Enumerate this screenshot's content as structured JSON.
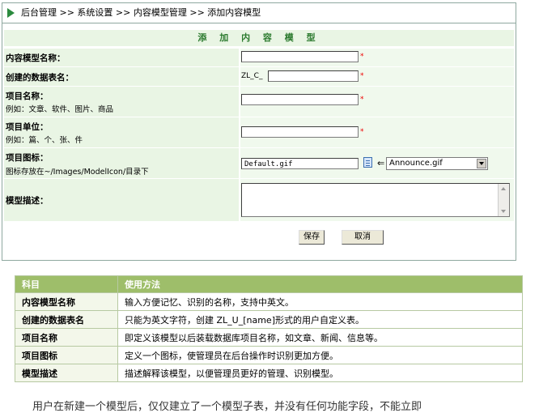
{
  "breadcrumb": {
    "text": "后台管理 >> 系统设置 >> 内容模型管理 >> 添加内容模型"
  },
  "form": {
    "title": "添 加 内 容 模 型",
    "fields": [
      {
        "label": "内容模型名称：",
        "hint": ""
      },
      {
        "label": "创建的数据表名：",
        "hint": "",
        "prefix": "ZL_C_"
      },
      {
        "label": "项目名称：",
        "hint": "例如：文章、软件、图片、商品"
      },
      {
        "label": "项目单位：",
        "hint": "例如：篇、个、张、件"
      },
      {
        "label": "项目图标：",
        "hint": "图标存放在~/Images/ModelIcon/目录下",
        "value": "Default.gif",
        "arrow": "⇐",
        "select_value": "Announce.gif"
      },
      {
        "label": "模型描述：",
        "hint": ""
      }
    ],
    "required_mark": "*",
    "save_label": "保存",
    "cancel_label": "取消"
  },
  "table": {
    "headers": [
      "科目",
      "使用方法"
    ],
    "rows": [
      [
        "内容模型名称",
        "输入方便记忆、识别的名称，支持中英文。"
      ],
      [
        "创建的数据表名",
        "只能为英文字符，创建 ZL_U_[name]形式的用户自定义表。"
      ],
      [
        "项目名称",
        "即定义该模型以后装载数据库项目名称，如文章、新闻、信息等。"
      ],
      [
        "项目图标",
        "定义一个图标，使管理员在后台操作时识别更加方便。"
      ],
      [
        "模型描述",
        "描述解释该模型，以便管理员更好的管理、识别模型。"
      ]
    ]
  },
  "footer_note": "用户在新建一个模型后，仅仅建立了一个模型子表，并没有任何功能字段，不能立即"
}
